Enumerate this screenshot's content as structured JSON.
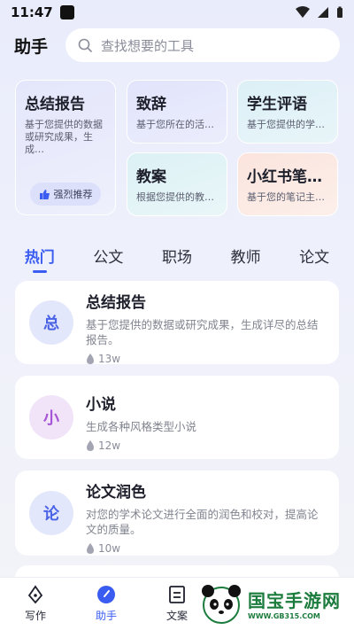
{
  "status": {
    "time": "11:47"
  },
  "header": {
    "title": "助手",
    "search_placeholder": "查找想要的工具"
  },
  "featured": {
    "big": {
      "title": "总结报告",
      "desc": "基于您提供的数据或研究成果，生成…",
      "badge": "强烈推荐"
    },
    "cards": [
      {
        "title": "致辞",
        "desc": "基于您所在的活动…"
      },
      {
        "title": "学生评语",
        "desc": "基于您提供的学生…"
      },
      {
        "title": "教案",
        "desc": "根据您提供的教训…"
      },
      {
        "title": "小红书笔…",
        "desc": "基于您的笔记主题…"
      }
    ]
  },
  "tabs": [
    "热门",
    "公文",
    "职场",
    "教师",
    "论文"
  ],
  "list": [
    {
      "avatar": "总",
      "title": "总结报告",
      "desc": "基于您提供的数据或研究成果，生成详尽的总结报告。",
      "count": "13w"
    },
    {
      "avatar": "小",
      "title": "小说",
      "desc": "生成各种风格类型小说",
      "count": "12w"
    },
    {
      "avatar": "论",
      "title": "论文润色",
      "desc": "对您的学术论文进行全面的润色和校对，提高论文的质量。",
      "count": "10w"
    }
  ],
  "bottom_nav": [
    "写作",
    "助手",
    "文案"
  ],
  "watermark": {
    "title": "国宝手游网",
    "url": "WWW.GB315.COM"
  },
  "colors": {
    "accent": "#3a5cf0"
  }
}
